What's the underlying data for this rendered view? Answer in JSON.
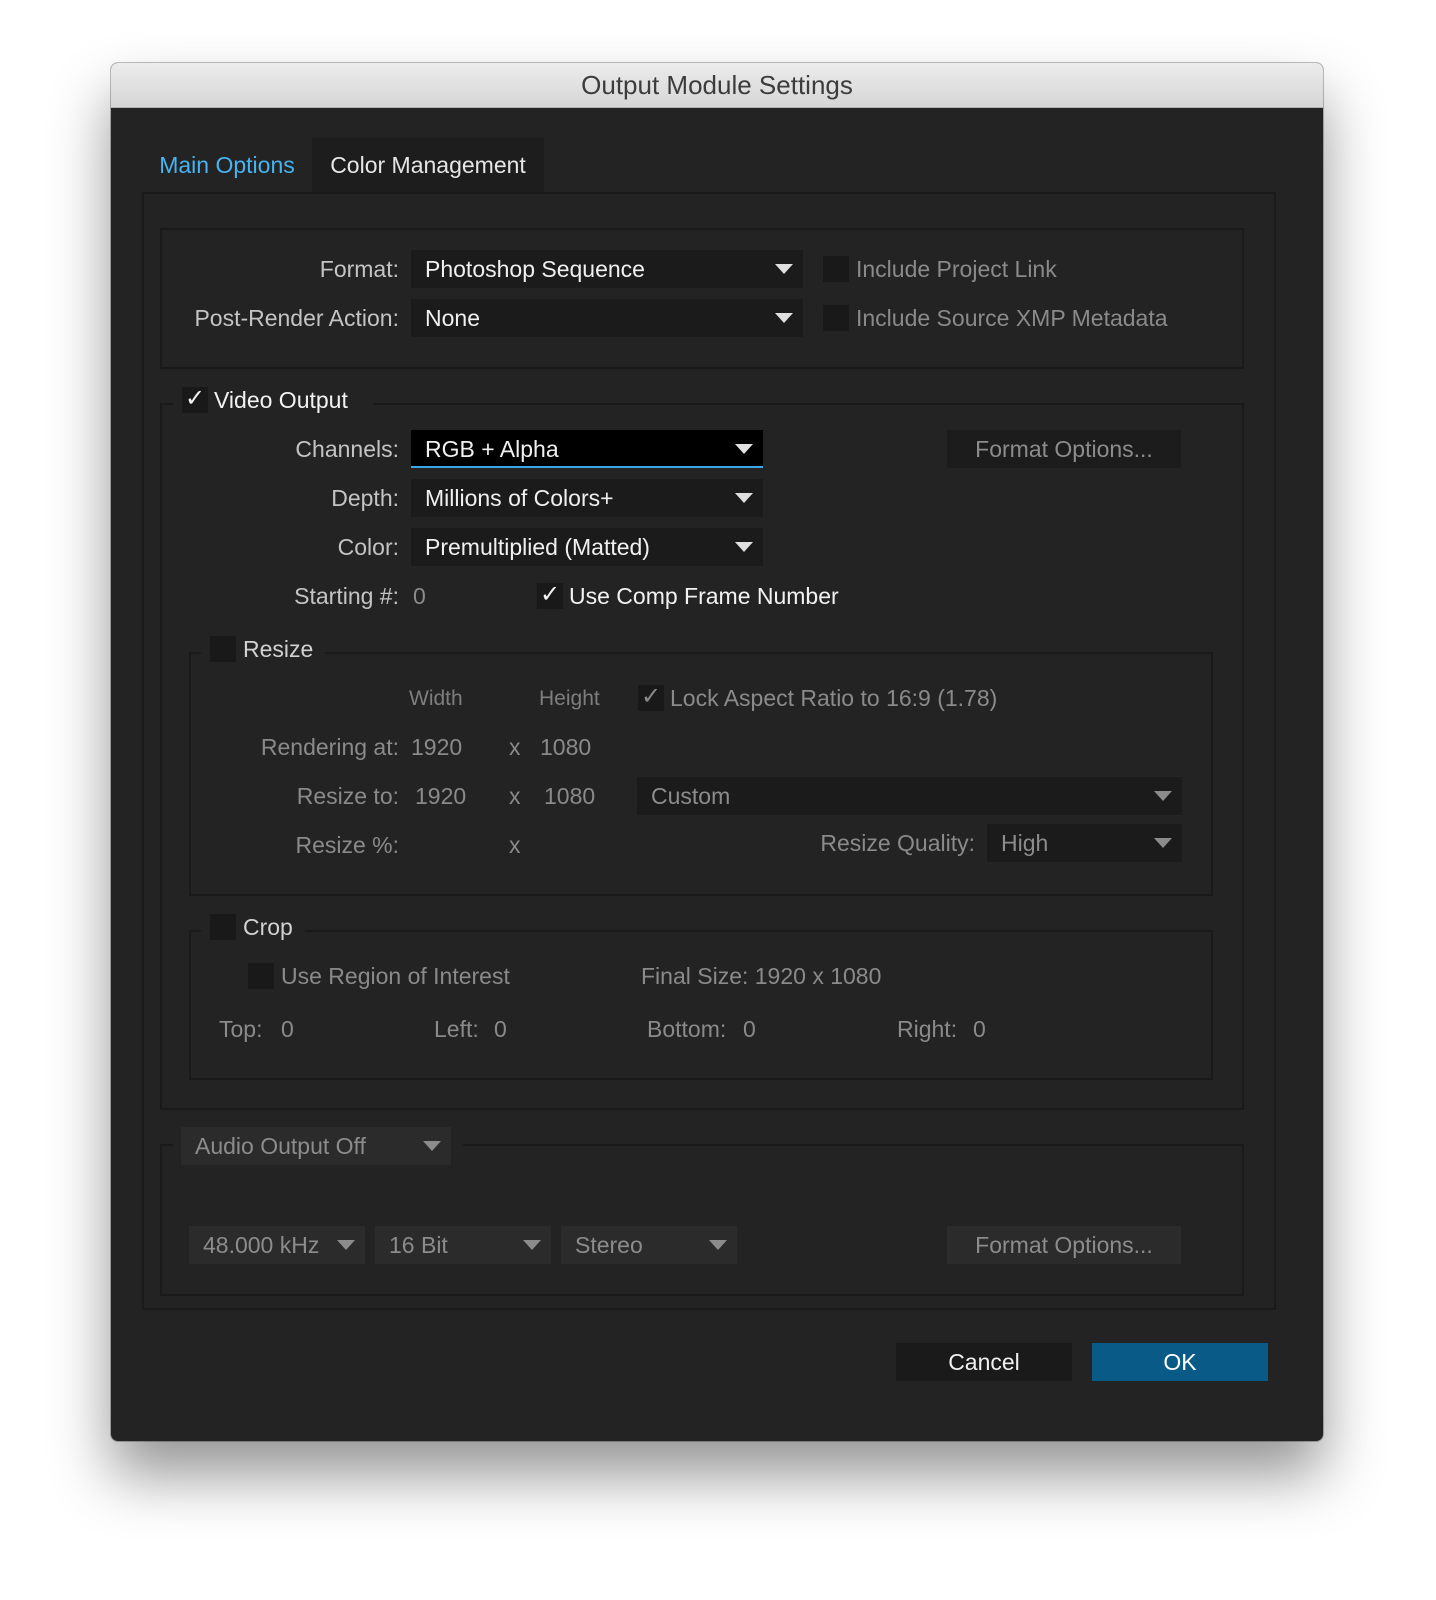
{
  "window": {
    "title": "Output Module Settings"
  },
  "tabs": [
    {
      "label": "Main Options",
      "active": true
    },
    {
      "label": "Color Management",
      "active": false
    }
  ],
  "format_section": {
    "format_label": "Format:",
    "format_value": "Photoshop Sequence",
    "post_render_label": "Post-Render Action:",
    "post_render_value": "None",
    "include_project_link": {
      "label": "Include Project Link",
      "checked": false
    },
    "include_xmp": {
      "label": "Include Source XMP Metadata",
      "checked": false
    }
  },
  "video_output": {
    "label": "Video Output",
    "checked": true,
    "check_glyph": "✓",
    "channels_label": "Channels:",
    "channels_value": "RGB + Alpha",
    "depth_label": "Depth:",
    "depth_value": "Millions of Colors+",
    "color_label": "Color:",
    "color_value": "Premultiplied (Matted)",
    "starting_label": "Starting #:",
    "starting_value": "0",
    "use_comp_frame": {
      "label": "Use Comp Frame Number",
      "checked": true
    },
    "format_options_label": "Format Options..."
  },
  "resize": {
    "label": "Resize",
    "checked": false,
    "width_header": "Width",
    "height_header": "Height",
    "lock_aspect": {
      "label": "Lock Aspect Ratio to 16:9 (1.78)",
      "checked": true
    },
    "rendering_label": "Rendering at:",
    "rendering_w": "1920",
    "rendering_h": "1080",
    "resize_to_label": "Resize to:",
    "resize_to_w": "1920",
    "resize_to_h": "1080",
    "preset_value": "Custom",
    "percent_label": "Resize %:",
    "x": "x",
    "quality_label": "Resize Quality:",
    "quality_value": "High"
  },
  "crop": {
    "label": "Crop",
    "checked": false,
    "use_roi": {
      "label": "Use Region of Interest",
      "checked": false
    },
    "final_size": "Final Size: 1920 x 1080",
    "top_label": "Top:",
    "top_value": "0",
    "left_label": "Left:",
    "left_value": "0",
    "bottom_label": "Bottom:",
    "bottom_value": "0",
    "right_label": "Right:",
    "right_value": "0"
  },
  "audio": {
    "mode_value": "Audio Output Off",
    "rate_value": "48.000 kHz",
    "bits_value": "16 Bit",
    "channels_value": "Stereo",
    "format_options_label": "Format Options..."
  },
  "footer": {
    "cancel_label": "Cancel",
    "ok_label": "OK"
  },
  "colors": {
    "accent_tab": "#47b3f0",
    "ok_button": "#0a5a88",
    "dialog_bg": "#232323"
  }
}
